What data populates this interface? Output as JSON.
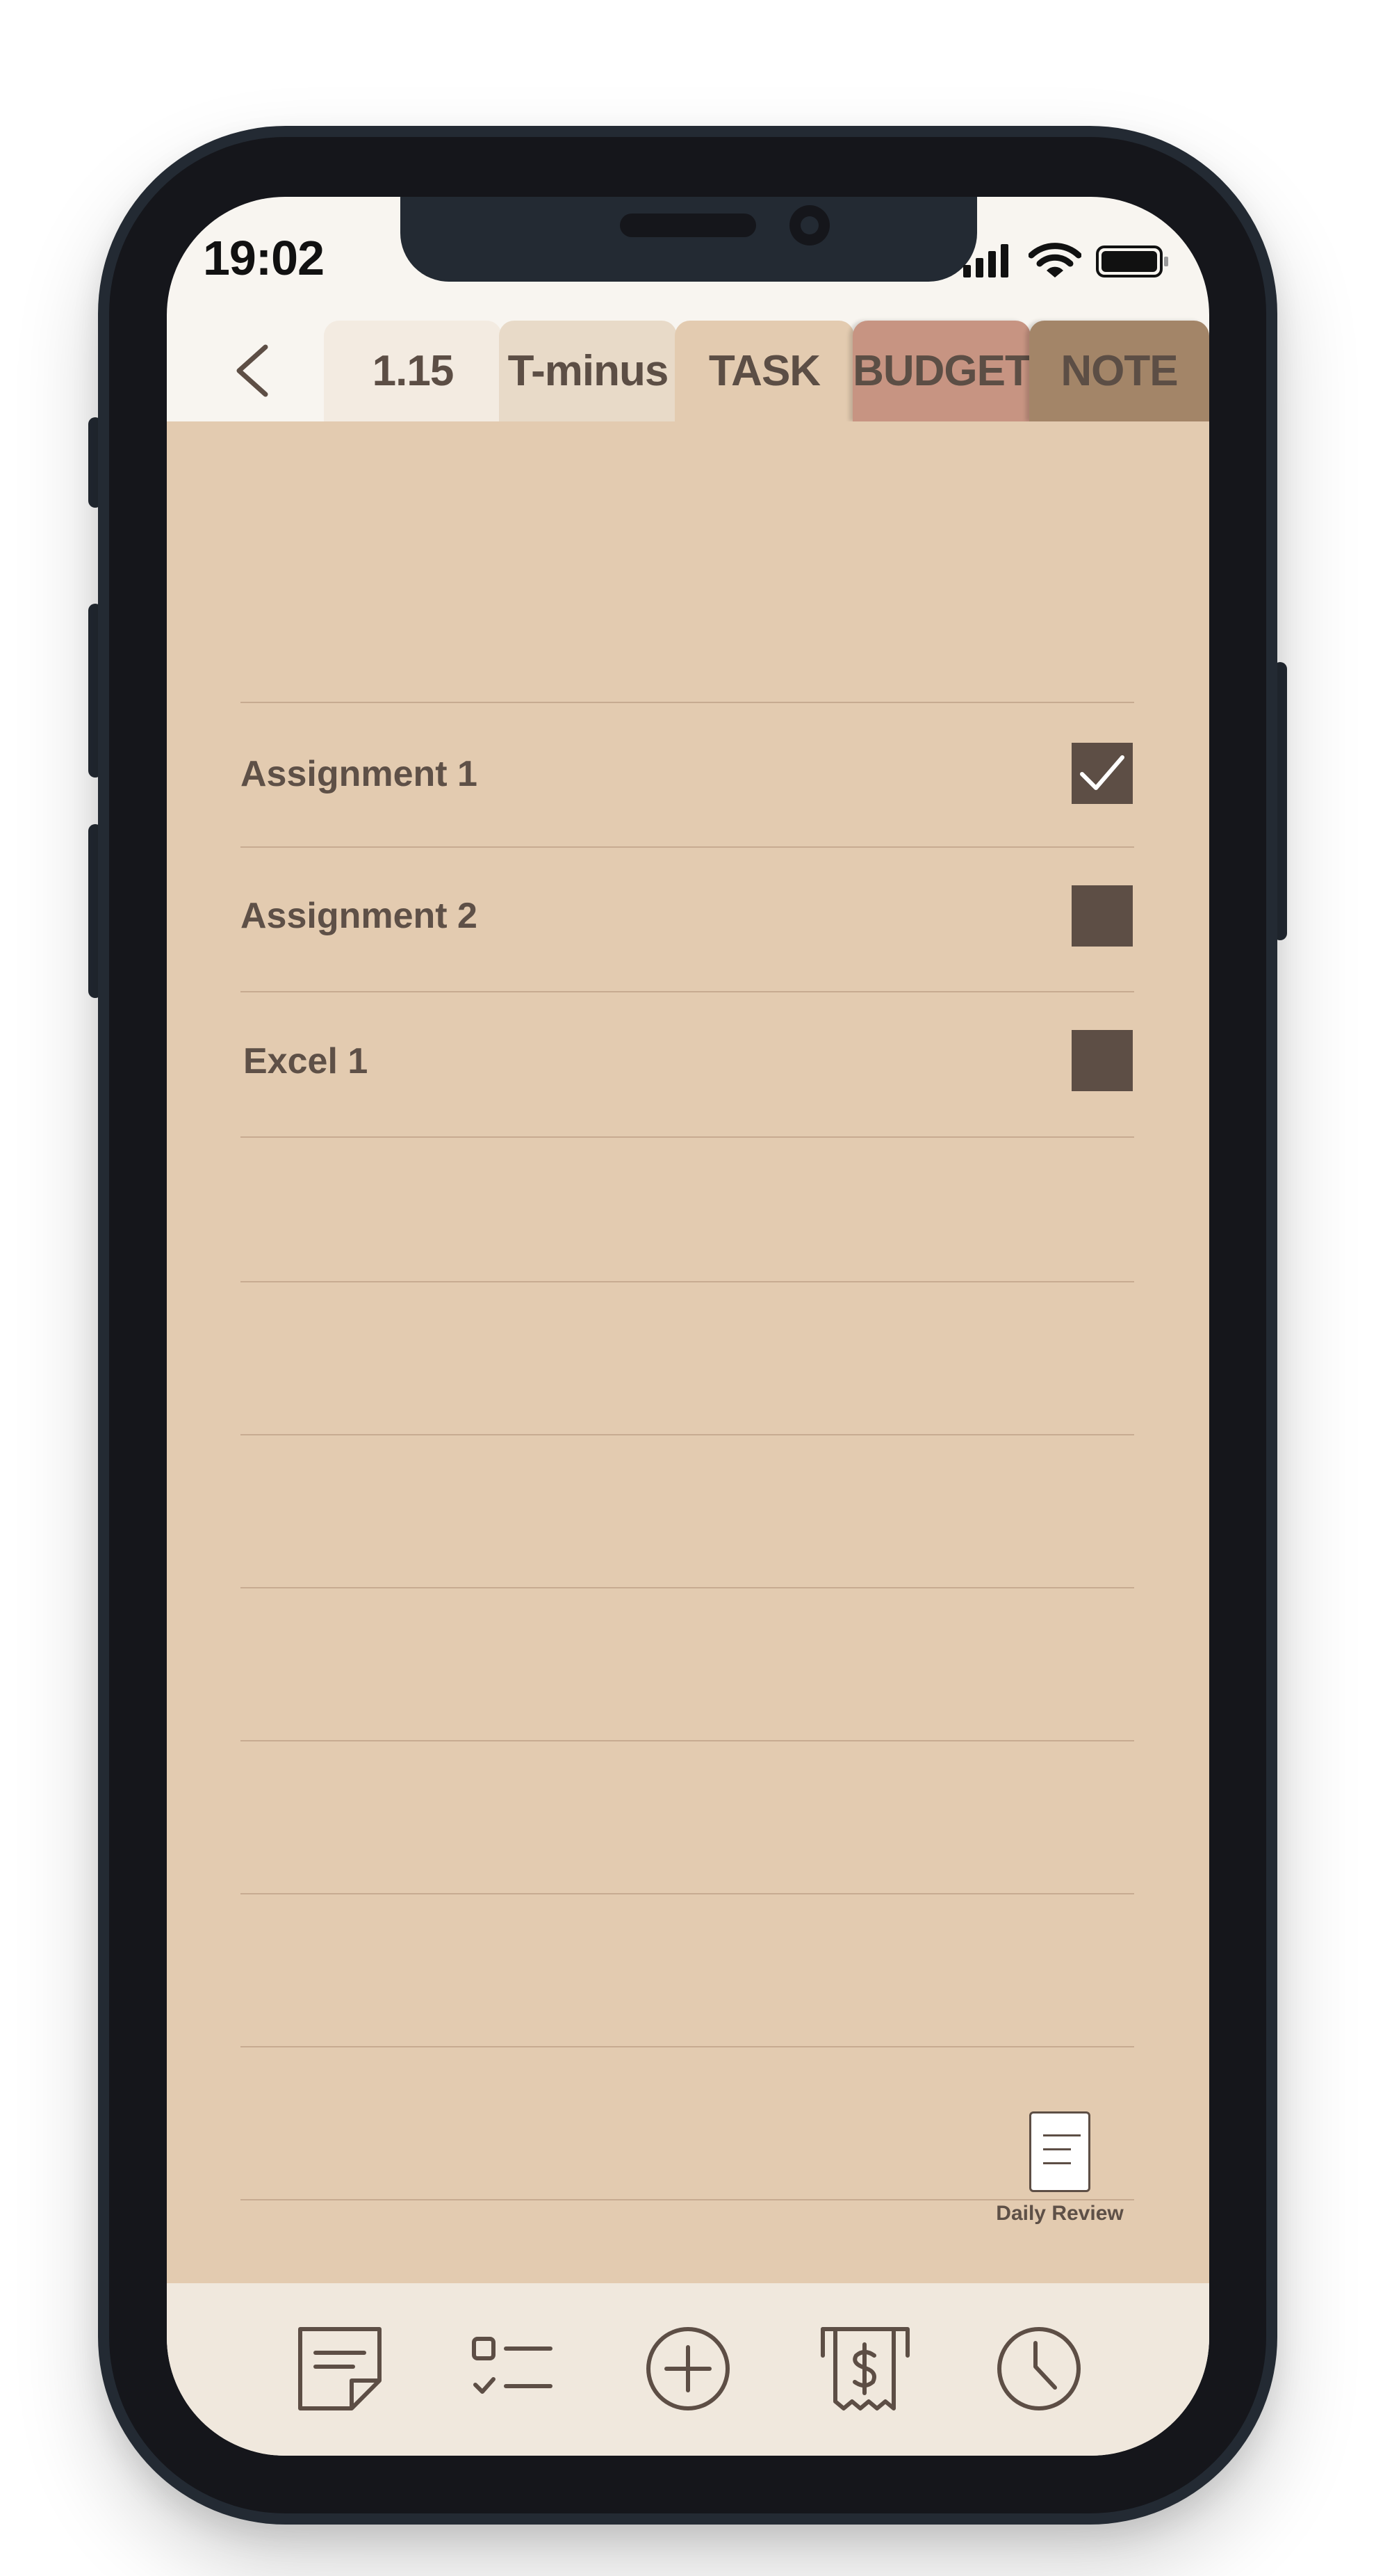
{
  "status_bar": {
    "time": "19:02"
  },
  "tabs": [
    {
      "label": "1.15",
      "color": "#f3ebe1"
    },
    {
      "label": "T-minus",
      "color": "#e8dac8"
    },
    {
      "label": "TASK",
      "color": "#e3cbb0",
      "active": true
    },
    {
      "label": "BUDGET",
      "color": "#c79482"
    },
    {
      "label": "NOTE",
      "color": "#a38568"
    }
  ],
  "tasks": [
    {
      "label": "Assignment 1",
      "checked": true
    },
    {
      "label": "Assignment 2",
      "checked": false
    },
    {
      "label": "Excel 1",
      "checked": false
    }
  ],
  "daily_review": {
    "label": "Daily Review",
    "icon": "document-icon"
  },
  "bottom_nav": [
    {
      "icon": "sticky-note-icon"
    },
    {
      "icon": "checklist-icon"
    },
    {
      "icon": "add-circle-icon"
    },
    {
      "icon": "receipt-dollar-icon"
    },
    {
      "icon": "clock-icon"
    }
  ],
  "colors": {
    "accent": "#5d4e45",
    "task_background": "#e3cbb0",
    "nav_background": "#f0e8dd"
  }
}
